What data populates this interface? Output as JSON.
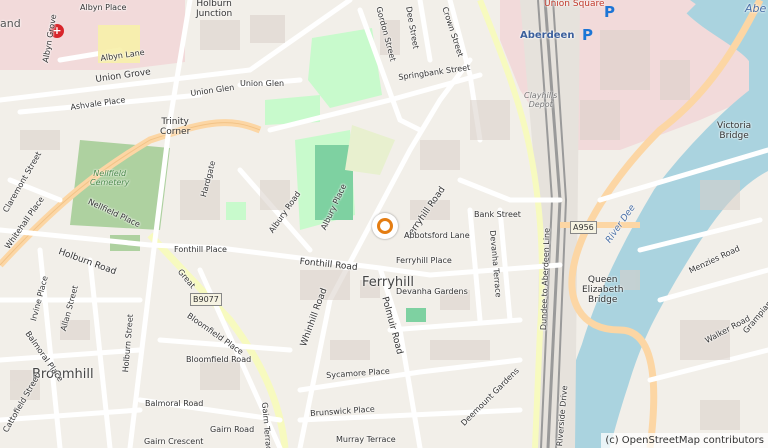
{
  "map": {
    "attribution": "(c) OpenStreetMap contributors",
    "colors": {
      "background": "#f2efe9",
      "water": "#aad3df",
      "park": "#c8facc",
      "building": "#d9d0c9",
      "primary": "#fcd6a4",
      "secondary": "#f7fabf",
      "railway": "#9a9a9a",
      "marker": "#e47d12"
    },
    "areas": {
      "ferryhill": "Ferryhill",
      "broomhill": "Broomhill",
      "trinity_corner": "Trinity\nCorner",
      "holburn_junction": "Holburn\nJunction",
      "nellfield_cemetery": "Nellfield\nCemetery",
      "queen_elizabeth_bridge": "Queen\nElizabeth\nBridge",
      "victoria_bridge": "Victoria\nBridge",
      "river_dee": "River Dee",
      "union_square": "Union Square",
      "aberdeen_station": "Aberdeen",
      "clayhills_depot": "Clayhills\nDepot",
      "edge_label_left": "and",
      "edge_label_right": "Abe"
    },
    "shields": {
      "a956": "A956",
      "b9077": "B9077"
    },
    "streets": {
      "albyn_place": "Albyn Place",
      "albyn_grove": "Albyn Grove",
      "albyn_lane": "Albyn Lane",
      "union_grove": "Union Grove",
      "union_glen": "Union Glen",
      "ashvale_place": "Ashvale Place",
      "claremont_street": "Claremont Street",
      "nellfield_place": "Nellfield Place",
      "holburn_road": "Holburn Road",
      "fonthill_place": "Fonthill Place",
      "fonthill_road": "Fonthill Road",
      "great": "Great",
      "hardgate": "Hardgate",
      "albury_road": "Albury Road",
      "albury_place": "Albury Place",
      "whinhill_road": "Whinhill Road",
      "ferryhill_road": "Ferryhill Road",
      "abbotsford_lane": "Abbotsford Lane",
      "ferryhill_place": "Ferryhill Place",
      "devanha_gardens": "Devanha Gardens",
      "polmuir_road": "Polmuir Road",
      "devanha_terrace": "Devanha Terrace",
      "bank_street": "Bank Street",
      "springbank_street": "Springbank Street",
      "crown_street": "Crown Street",
      "dee_street": "Dee Street",
      "gordon_street": "Gordon Street",
      "dundee_to_aberdeen_line": "Dundee to Aberdeen Line",
      "menzies_road": "Menzies Road",
      "walker_road": "Walker Road",
      "grampian_road": "Grampian R",
      "irvine_place": "Irvine Place",
      "allan_street": "Allan Street",
      "balmoral_road": "Balmoral Road",
      "balmoral_place": "Balmoral Place",
      "bloomfield_place": "Bloomfield Place",
      "bloomfield_road": "Bloomfield Road",
      "gairn_road": "Gairn Road",
      "gairn_crescent": "Gairn Crescent",
      "gairn_terrace": "Gairn Terrace",
      "holburn_street": "Holburn Street",
      "sycamore_place": "Sycamore Place",
      "brunswick_place": "Brunswick Place",
      "murray_terrace": "Murray Terrace",
      "deemount_gardens": "Deemount Gardens",
      "riverside_drive": "Riverside Drive",
      "cattofield_street": "Cattofield Street",
      "whitehall_place": "Whitehall Place"
    }
  }
}
